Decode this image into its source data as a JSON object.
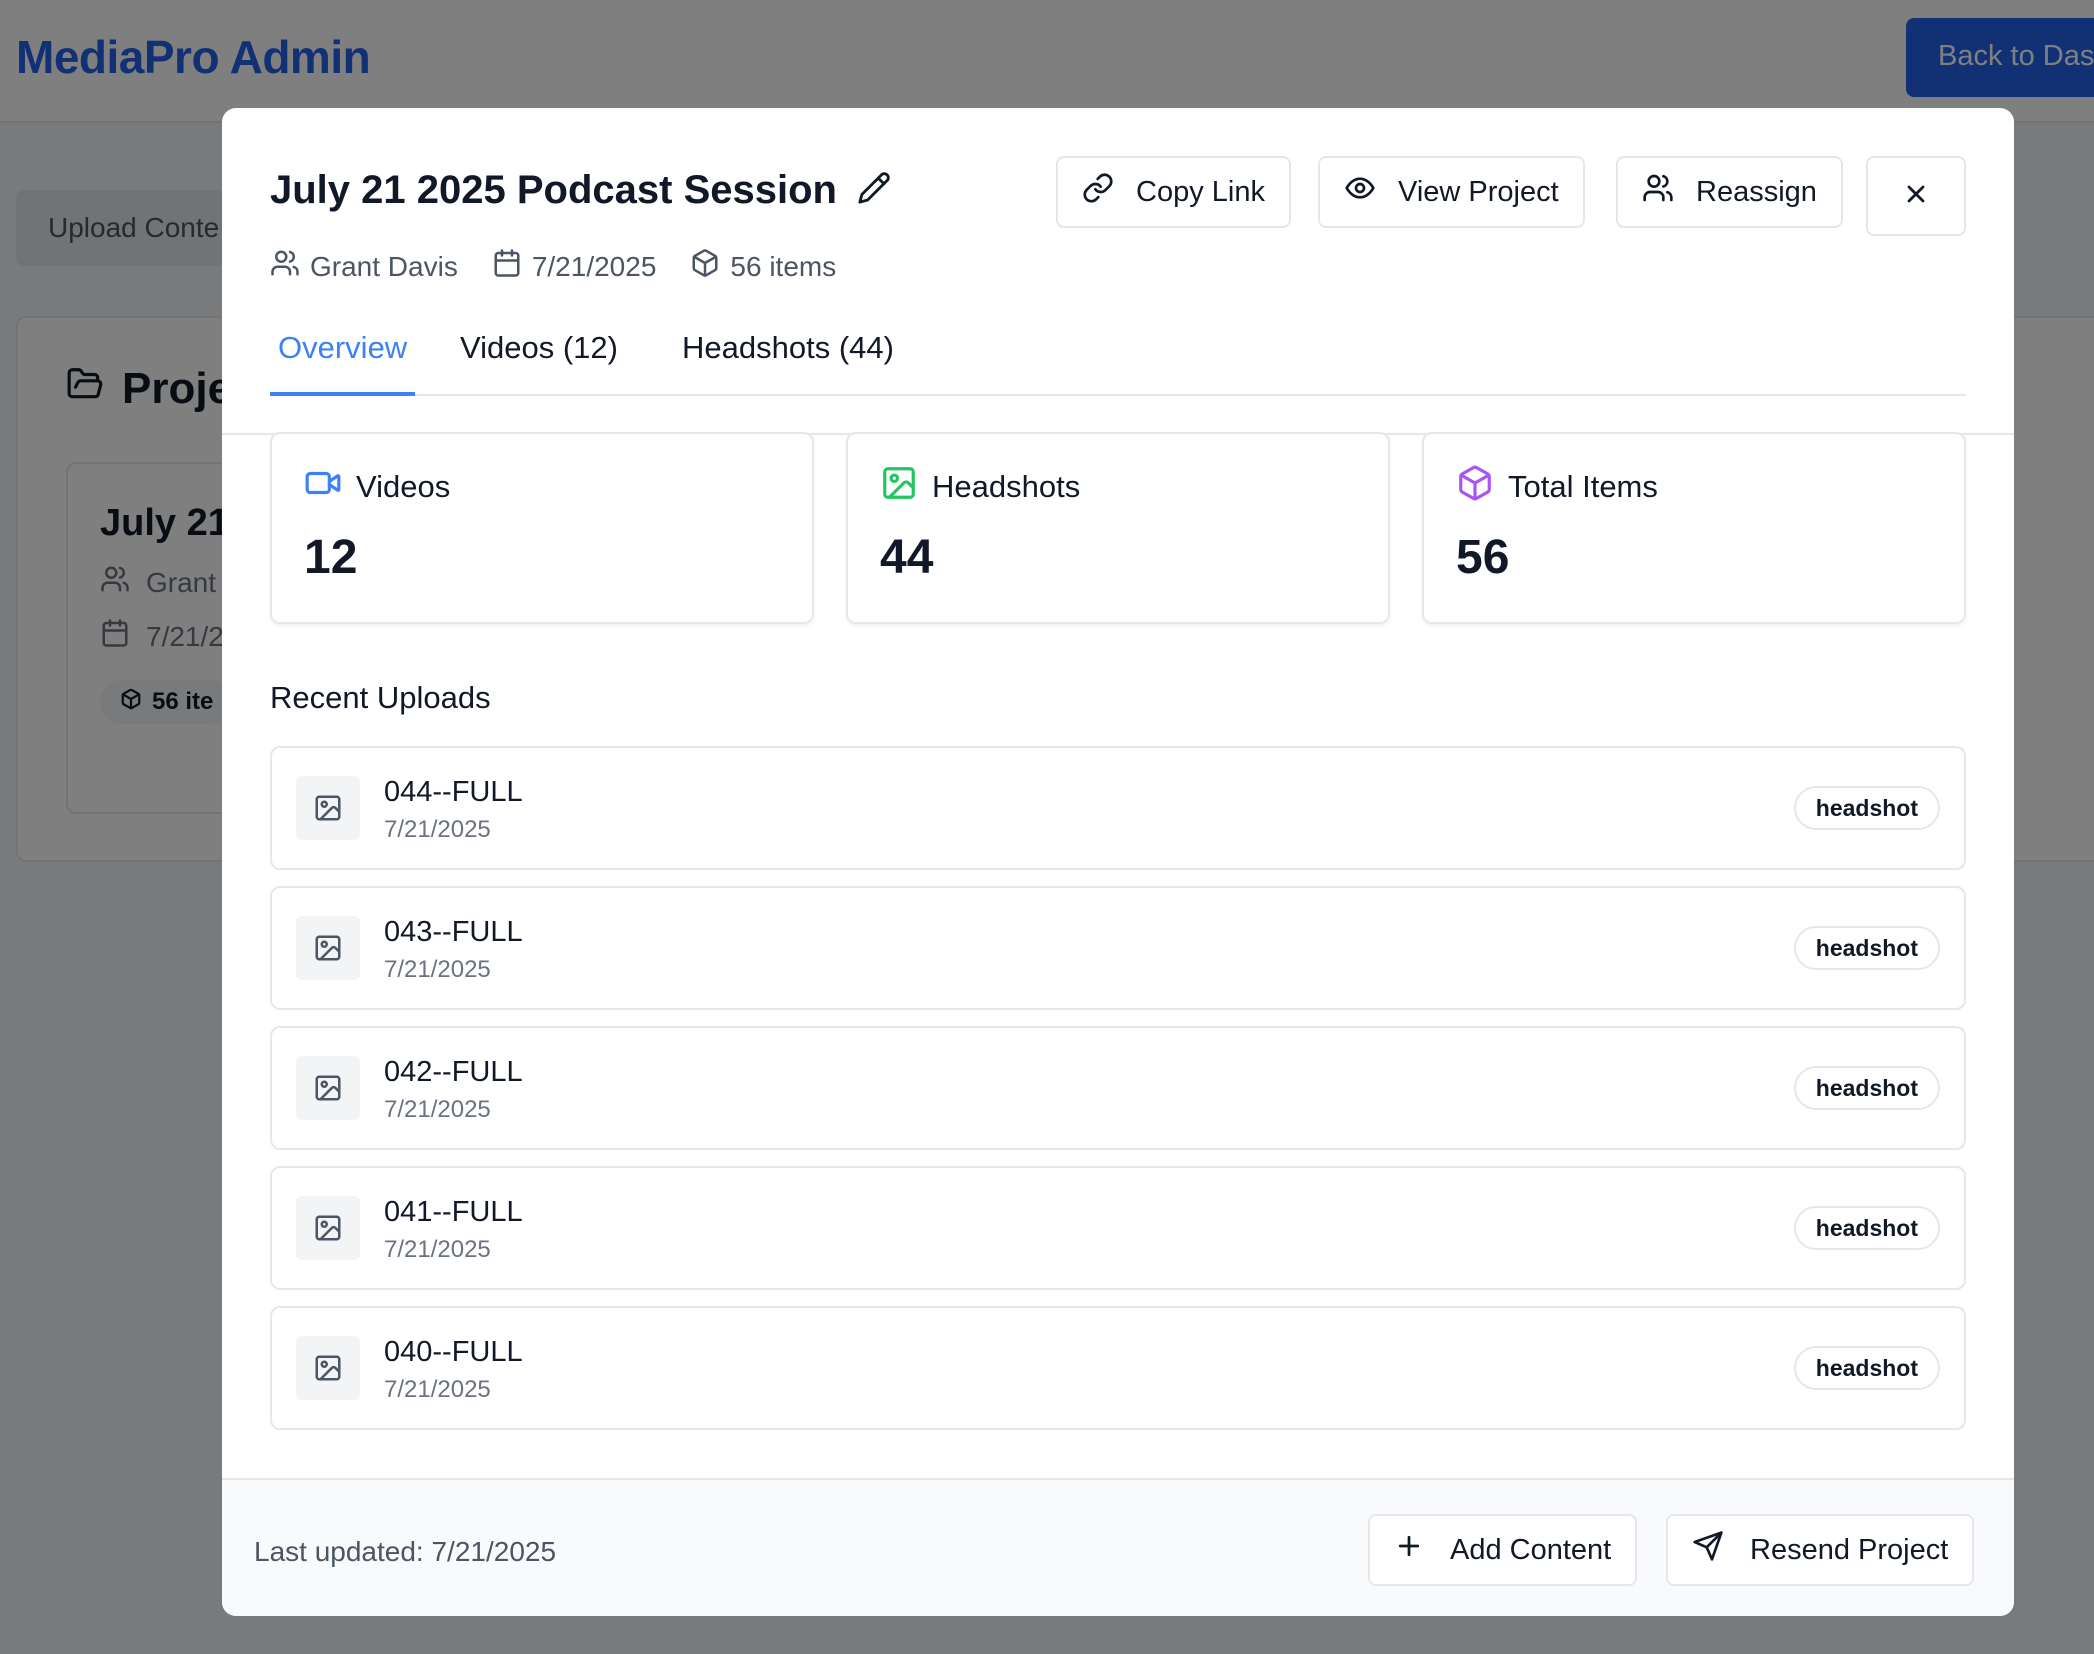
{
  "app": {
    "brand": "MediaPro Admin",
    "back_button": "Back to Das"
  },
  "background": {
    "upload_tab": "Upload Conte",
    "projects_heading": "Proje",
    "card": {
      "title": "July 21",
      "owner": "Grant",
      "date": "7/21/2",
      "items": "56 ite"
    }
  },
  "modal": {
    "title": "July 21 2025 Podcast Session",
    "meta": {
      "owner": "Grant Davis",
      "date": "7/21/2025",
      "items": "56 items"
    },
    "actions": {
      "copy_link": "Copy Link",
      "view_project": "View Project",
      "reassign": "Reassign"
    },
    "tabs": [
      {
        "label": "Overview",
        "active": true
      },
      {
        "label": "Videos (12)",
        "active": false
      },
      {
        "label": "Headshots (44)",
        "active": false
      }
    ],
    "stats": [
      {
        "label": "Videos",
        "value": "12",
        "icon": "video-icon",
        "color": "#3b82f6"
      },
      {
        "label": "Headshots",
        "value": "44",
        "icon": "image-icon",
        "color": "#22c55e"
      },
      {
        "label": "Total Items",
        "value": "56",
        "icon": "package-icon",
        "color": "#a855f7"
      }
    ],
    "recent_title": "Recent Uploads",
    "recent_uploads": [
      {
        "name": "044--FULL",
        "date": "7/21/2025",
        "type": "headshot"
      },
      {
        "name": "043--FULL",
        "date": "7/21/2025",
        "type": "headshot"
      },
      {
        "name": "042--FULL",
        "date": "7/21/2025",
        "type": "headshot"
      },
      {
        "name": "041--FULL",
        "date": "7/21/2025",
        "type": "headshot"
      },
      {
        "name": "040--FULL",
        "date": "7/21/2025",
        "type": "headshot"
      }
    ],
    "footer": {
      "last_updated": "Last updated: 7/21/2025",
      "add_content": "Add Content",
      "resend_project": "Resend Project"
    }
  },
  "colors": {
    "accent": "#3b82f6",
    "brand": "#2563eb",
    "overlay": "rgba(0,0,0,0.5)"
  }
}
